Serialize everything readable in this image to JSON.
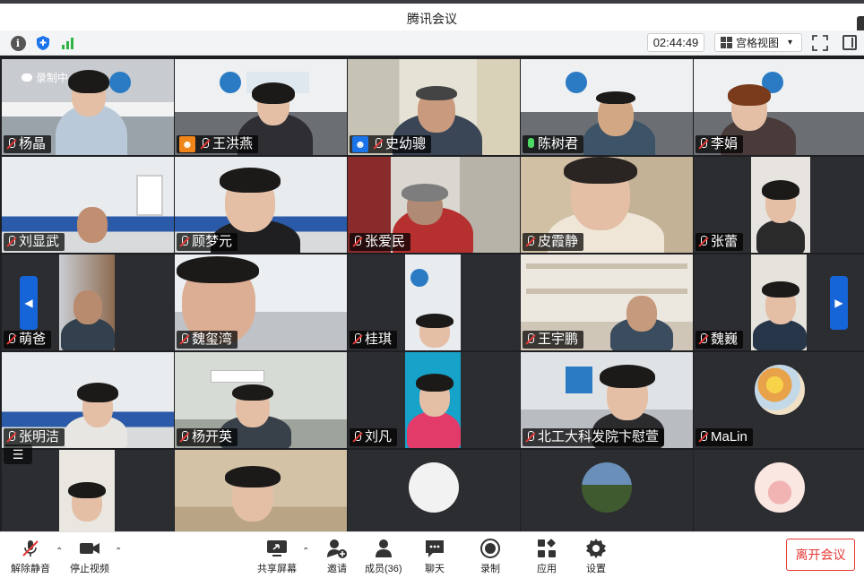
{
  "window": {
    "title": "腾讯会议"
  },
  "infobar": {
    "timer": "02:44:49",
    "view_label": "宫格视图",
    "view_caret": "▾"
  },
  "recording": {
    "label": "录制中"
  },
  "participants": [
    {
      "name": "杨晶"
    },
    {
      "name": "王洪燕"
    },
    {
      "name": "史幼骢"
    },
    {
      "name": "陈树君"
    },
    {
      "name": "李娟"
    },
    {
      "name": "刘显武"
    },
    {
      "name": "顾梦元"
    },
    {
      "name": "张爱民"
    },
    {
      "name": "皮霞静"
    },
    {
      "name": "张蕾"
    },
    {
      "name": "萌爸"
    },
    {
      "name": "魏玺湾"
    },
    {
      "name": "桂琪"
    },
    {
      "name": "王宇鹏"
    },
    {
      "name": "魏巍"
    },
    {
      "name": "张明洁"
    },
    {
      "name": "杨开英"
    },
    {
      "name": "刘凡"
    },
    {
      "name": "北工大科发院卞慰萱"
    },
    {
      "name": "MaLin"
    }
  ],
  "toolbar": {
    "unmute": "解除静音",
    "stop_video": "停止视频",
    "share_screen": "共享屏幕",
    "invite": "邀请",
    "members": "成员(36)",
    "chat": "聊天",
    "record": "录制",
    "apps": "应用",
    "settings": "设置",
    "leave": "离开会议"
  },
  "icons": [
    "info-icon",
    "shield-icon",
    "signal-icon",
    "grid-view-icon",
    "fullscreen-icon",
    "side-panel-icon",
    "mic-muted-icon",
    "camera-icon",
    "share-screen-icon",
    "invite-icon",
    "members-icon",
    "chat-icon",
    "record-icon",
    "apps-icon",
    "settings-icon"
  ],
  "colors": {
    "accent": "#1565d8",
    "danger": "#e53935",
    "mic_on": "#4cd964",
    "host_badge": "#f0851a"
  }
}
